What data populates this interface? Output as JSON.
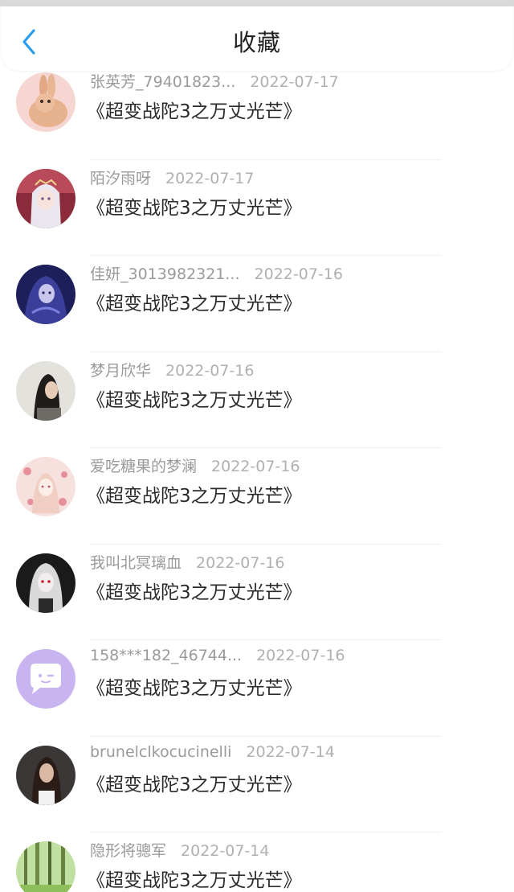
{
  "header": {
    "title": "收藏",
    "back_icon": "chevron-left-icon",
    "accent_color": "#2b9bf0"
  },
  "items": [
    {
      "user": "张英芳_79401823...",
      "date": "2022-07-17",
      "work": "《超变战陀3之万丈光芒》",
      "avatar": "rabbit"
    },
    {
      "user": "陌汐雨呀",
      "date": "2022-07-17",
      "work": "《超变战陀3之万丈光芒》",
      "avatar": "anime-white-hair"
    },
    {
      "user": "佳妍_3013982321...",
      "date": "2022-07-16",
      "work": "《超变战陀3之万丈光芒》",
      "avatar": "anime-blue"
    },
    {
      "user": "梦月欣华",
      "date": "2022-07-16",
      "work": "《超变战陀3之万丈光芒》",
      "avatar": "girl-photo"
    },
    {
      "user": "爱吃糖果的梦澜",
      "date": "2022-07-16",
      "work": "《超变战陀3之万丈光芒》",
      "avatar": "anime-pink"
    },
    {
      "user": "我叫北冥璃血",
      "date": "2022-07-16",
      "work": "《超变战陀3之万丈光芒》",
      "avatar": "anime-dark"
    },
    {
      "user": "158***182_46744...",
      "date": "2022-07-16",
      "work": "《超变战陀3之万丈光芒》",
      "avatar": "chat-bubble-default"
    },
    {
      "user": "brunelclkocucinelli",
      "date": "2022-07-14",
      "work": "《超变战陀3之万丈光芒》",
      "avatar": "woman-photo"
    },
    {
      "user": "隐形将骢军",
      "date": "2022-07-14",
      "work": "《超变战陀3之万丈光芒》",
      "avatar": "forest"
    }
  ]
}
